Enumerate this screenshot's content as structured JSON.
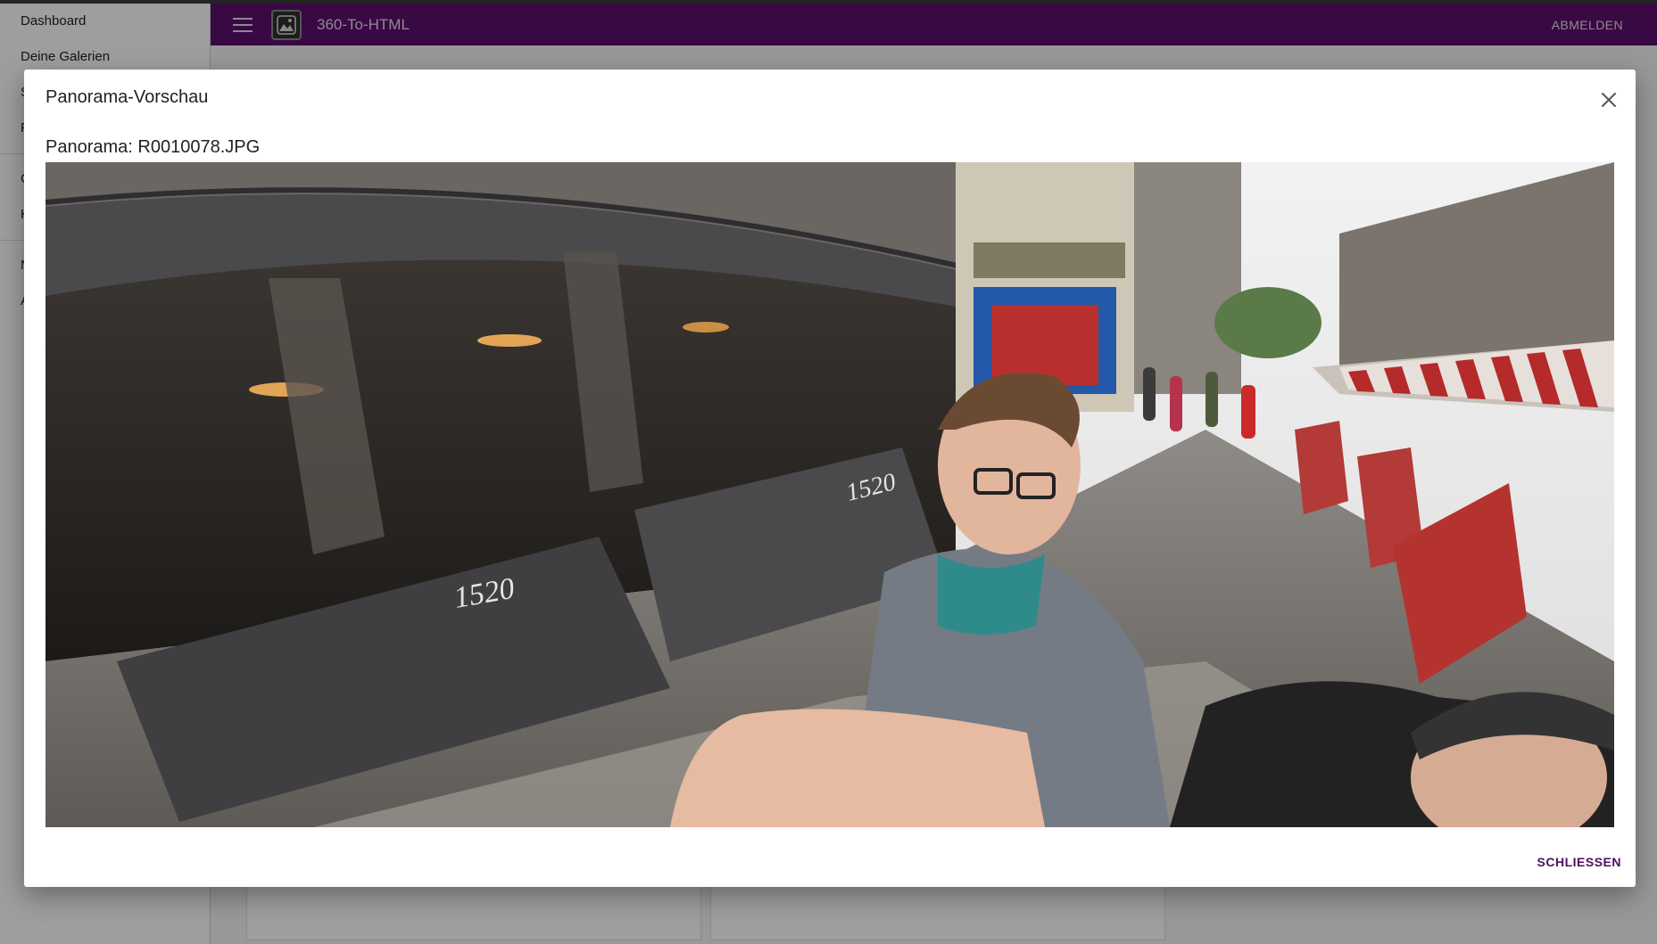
{
  "sidebar": {
    "items": [
      {
        "label": "Dashboard"
      },
      {
        "label": "Deine Galerien"
      }
    ]
  },
  "header": {
    "app_title": "360-To-HTML",
    "logout_label": "ABMELDEN",
    "brand_color": "#5d0f6e",
    "menu_icon": "menu-icon",
    "logo_icon": "app-logo-icon"
  },
  "dialog": {
    "title": "Panorama-Vorschau",
    "panorama_label": "Panorama: R0010078.JPG",
    "close_label": "SCHLIESSEN",
    "close_icon": "close-icon",
    "accent_color": "#4d1060"
  }
}
